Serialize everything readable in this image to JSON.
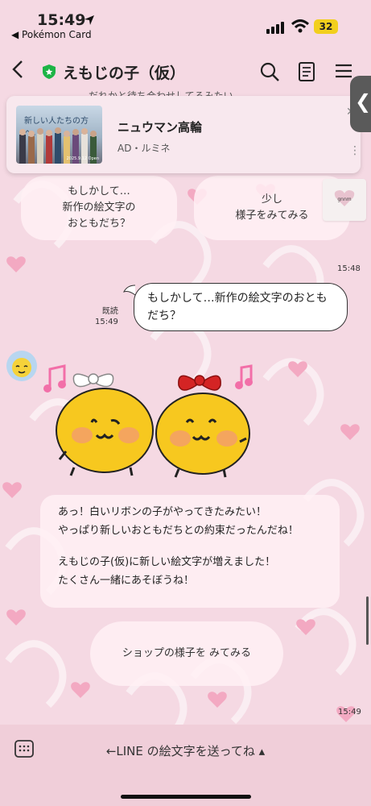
{
  "status_bar": {
    "time": "15:49",
    "back_app": "◀ Pokémon Card",
    "battery": "32"
  },
  "header": {
    "title": "えもじの子（仮）",
    "icons": [
      "back-chevron-icon",
      "verified-shield-icon",
      "search-icon",
      "notes-icon",
      "menu-icon"
    ]
  },
  "top_clip": "だれかと待ち合わせしてるみたい",
  "ad": {
    "thumb_text": "新しい人たちの方へ。",
    "thumb_date": "2025.9.12 Open",
    "title": "ニュウマン高輪",
    "sub": "AD・ルミネ"
  },
  "choices": {
    "left": "もしかして…\n新作の絵文字の\nおともだち？",
    "right": "少し\n様子をみてみる"
  },
  "sticker_label": "gnnm",
  "sent": {
    "time": "15:48",
    "text": "もしかして…新作の絵文字のおともだち？",
    "read_label": "既読",
    "read_time": "15:49"
  },
  "reply": {
    "line1": "あっ！白いリボンの子がやってきたみたい！\nやっぱり新しいおともだちとの約束だったんだね！",
    "line2": "えもじの子(仮)に新しい絵文字が増えました！\nたくさん一緒にあそぼうね！"
  },
  "shop_button": "ショップの様子を みてみる",
  "last_time": "15:49",
  "bottom_bar": {
    "text": "←LINE の絵文字を送ってね ▴"
  },
  "colors": {
    "background": "#f5d9e3",
    "accent_shield": "#1db446",
    "bottom_bar": "#f0ced9",
    "bubble_border": "#333333"
  }
}
